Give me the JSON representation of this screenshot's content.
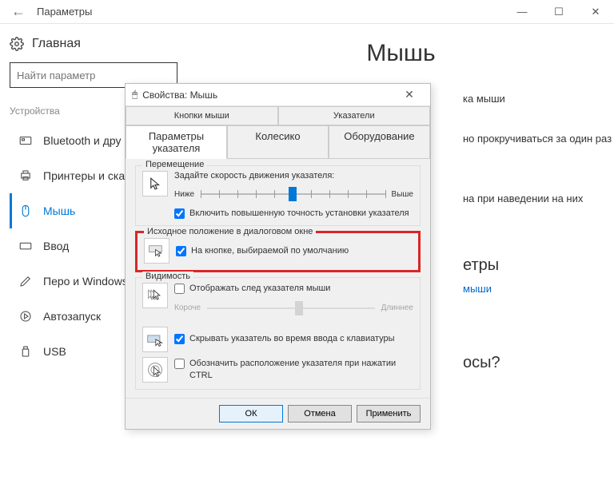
{
  "window": {
    "title": "Параметры"
  },
  "sidebar": {
    "home": "Главная",
    "search_placeholder": "Найти параметр",
    "category": "Устройства",
    "items": [
      {
        "label": "Bluetooth и дру"
      },
      {
        "label": "Принтеры и ска"
      },
      {
        "label": "Мышь"
      },
      {
        "label": "Ввод"
      },
      {
        "label": "Перо и Windows"
      },
      {
        "label": "Автозапуск"
      },
      {
        "label": "USB"
      }
    ]
  },
  "main": {
    "heading": "Мышь",
    "line1": "ка мыши",
    "line2": "но прокручиваться за один раз",
    "line3": "на при наведении на них",
    "subhead1": "етры",
    "link1": "мыши",
    "subhead2": "осы?"
  },
  "dialog": {
    "title": "Свойства: Мышь",
    "tabs": {
      "t1": "Кнопки мыши",
      "t2": "Указатели",
      "t3": "Параметры указателя",
      "t4": "Колесико",
      "t5": "Оборудование"
    },
    "group_move": {
      "label": "Перемещение",
      "desc": "Задайте скорость движения указателя:",
      "low": "Ниже",
      "high": "Выше",
      "enhance": "Включить повышенную точность установки указателя"
    },
    "group_snap": {
      "label": "Исходное положение в диалоговом окне",
      "check": "На кнопке, выбираемой по умолчанию"
    },
    "group_vis": {
      "label": "Видимость",
      "trail": "Отображать след указателя мыши",
      "short": "Короче",
      "long": "Длиннее",
      "hide": "Скрывать указатель во время ввода с клавиатуры",
      "ctrl": "Обозначить расположение указателя при нажатии CTRL"
    },
    "buttons": {
      "ok": "ОК",
      "cancel": "Отмена",
      "apply": "Применить"
    }
  }
}
